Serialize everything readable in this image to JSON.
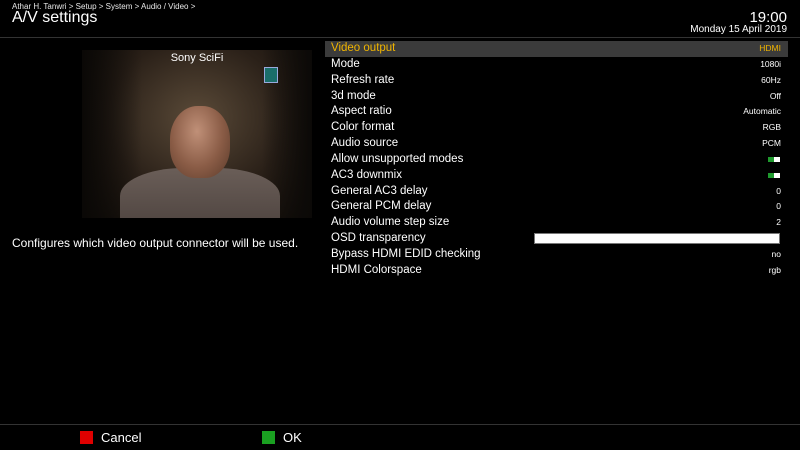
{
  "header": {
    "breadcrumb": "Athar H. Tanwri > Setup > System > Audio / Video >",
    "title": "A/V settings",
    "time": "19:00",
    "date": "Monday 15 April 2019"
  },
  "preview": {
    "channel_name": "Sony SciFi"
  },
  "help_text": "Configures which video output connector will be used.",
  "menu": {
    "items": [
      {
        "label": "Video output",
        "value": "HDMI",
        "type": "text",
        "selected": true
      },
      {
        "label": "Mode",
        "value": "1080i",
        "type": "text"
      },
      {
        "label": "Refresh rate",
        "value": "60Hz",
        "type": "text"
      },
      {
        "label": "3d mode",
        "value": "Off",
        "type": "text"
      },
      {
        "label": "Aspect ratio",
        "value": "Automatic",
        "type": "text"
      },
      {
        "label": "Color format",
        "value": "RGB",
        "type": "text"
      },
      {
        "label": "Audio source",
        "value": "PCM",
        "type": "text"
      },
      {
        "label": "Allow unsupported modes",
        "type": "toggle",
        "on": true
      },
      {
        "label": "AC3 downmix",
        "type": "toggle",
        "on": true
      },
      {
        "label": "General AC3 delay",
        "value": "0",
        "type": "text"
      },
      {
        "label": "General PCM delay",
        "value": "0",
        "type": "text"
      },
      {
        "label": "Audio volume step size",
        "value": "2",
        "type": "text"
      },
      {
        "label": "OSD transparency",
        "type": "slider"
      },
      {
        "label": "Bypass HDMI EDID checking",
        "value": "no",
        "type": "text"
      },
      {
        "label": "HDMI Colorspace",
        "value": "rgb",
        "type": "text"
      }
    ]
  },
  "footer": {
    "cancel_label": "Cancel",
    "ok_label": "OK"
  },
  "colors": {
    "selected_text": "#f0b400",
    "red_key": "#e00000",
    "green_key": "#1aa021",
    "toggle_on": "#1f9a2e"
  }
}
